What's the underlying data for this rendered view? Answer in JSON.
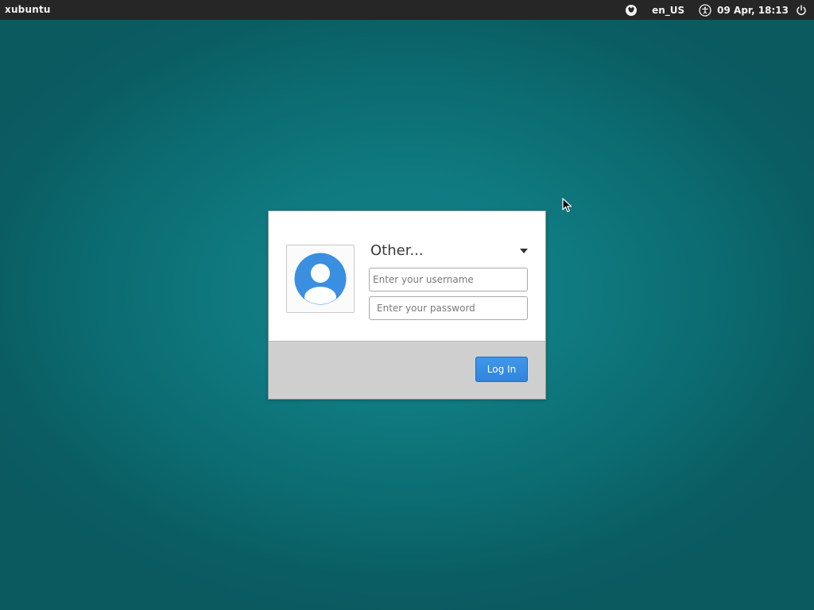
{
  "panel": {
    "hostname": "xubuntu",
    "language": "en_US",
    "clock": "09 Apr, 18:13",
    "icons": [
      "session-indicator-icon",
      "accessibility-icon",
      "power-icon"
    ]
  },
  "login": {
    "selected_user": "Other...",
    "username": {
      "value": "",
      "placeholder": "Enter your username"
    },
    "password": {
      "value": "",
      "placeholder": "Enter your password"
    },
    "login_button_label": "Log In",
    "avatar_icon": "default-user-avatar-icon"
  },
  "colors": {
    "panel_bg": "#262626",
    "desktop_bg": "#0f7a80",
    "button_accent": "#3a8fe3",
    "box_footer_bg": "#cfcfd0"
  }
}
